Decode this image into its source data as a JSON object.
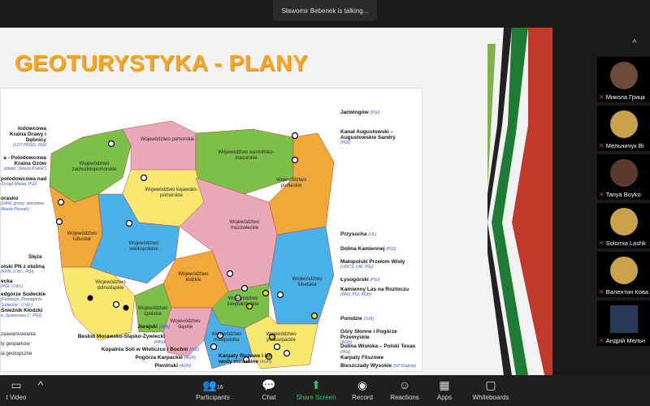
{
  "top_banner": {
    "speaker_text": "Sławomir Bebenek is talking..."
  },
  "slide": {
    "title": "GEOTURYSTYKA - PLANY",
    "regions": [
      {
        "name": "Województwo pomorskie"
      },
      {
        "name": "Województwo warmińsko-mazurskie"
      },
      {
        "name": "Województwo zachodniopomorskie"
      },
      {
        "name": "Województwo kujawsko-pomorskie"
      },
      {
        "name": "Województwo podlaskie"
      },
      {
        "name": "Województwo lubuskie"
      },
      {
        "name": "Województwo wielkopolskie"
      },
      {
        "name": "Województwo mazowieckie"
      },
      {
        "name": "Województwo łódzkie"
      },
      {
        "name": "Województwo lubelskie"
      },
      {
        "name": "Województwo dolnośląskie"
      },
      {
        "name": "Województwo opolskie"
      },
      {
        "name": "Województwo świętokrzyskie"
      },
      {
        "name": "Województwo śląskie"
      },
      {
        "name": "Województwo małopolskie"
      },
      {
        "name": "Województwo podkarpackie"
      }
    ],
    "left_annotations": [
      {
        "title": "lodowcowa Kraina Drawy i Dębnicy",
        "sub": "(LOT PKDiD, PGI)"
      },
      {
        "title": "a - Polodowcowa Kraina Ozów",
        "sub": "zdanie, „Nasza Kraina”)"
      },
      {
        "title": "polodowcowa nad",
        "sub": "(Urząd Miasta, PGI)"
      },
      {
        "title": "orasko",
        "sub": "(UAM, gminy, starostwo, Miasto Poznań)"
      },
      {
        "title": "Ślęża",
        "sub": ""
      },
      {
        "title": "olski PN z otuliną",
        "sub": "(KPN, U.Wr., PGI)"
      },
      {
        "title": "ecka",
        "sub": "(PGI, U.Wr.)"
      },
      {
        "title": "edgórze Sudeckie",
        "sub": "(Fundacja „Przedgórze Sudeckie”, U.Wr.)"
      },
      {
        "title": "Śnieżnik Kłodzki",
        "sub": "a „Spacerowa 1”, PGI)"
      }
    ],
    "right_annotations": [
      {
        "title": "Jaćwingów",
        "sub": "(PGI)"
      },
      {
        "title": "Kanał Augustowski – Augustowskie Sandry",
        "sub": "(PGI)"
      },
      {
        "title": "Przysucha",
        "sub": "(UL)"
      },
      {
        "title": "Dolina Kamiennej",
        "sub": "(PGI)"
      },
      {
        "title": "Małopolski Przełom Wisły",
        "sub": "(UMCS, UW, PGI)"
      },
      {
        "title": "Łysogórski",
        "sub": "(PGI)"
      },
      {
        "title": "Kamienny Las na Roztoczu",
        "sub": "(PAN, PGI, AGH)"
      },
      {
        "title": "Ponidzie",
        "sub": "(UJK)"
      },
      {
        "title": "Góry Słonne i Pogórze Przemyskie",
        "sub": "(AGH)"
      },
      {
        "title": "Dolina Wisłoka – Polski Texas",
        "sub": "(PGI)"
      },
      {
        "title": "Karpaty Fliszowe",
        "sub": ""
      },
      {
        "title": "Bieszczady Wysokie",
        "sub": "(UP Kraków)"
      }
    ],
    "bottom_annotations": [
      {
        "title": "Jurajski",
        "sub": "(PAN)"
      },
      {
        "title": "Beskid Morawsko-Śląsko-Żywiecki",
        "sub": "(PAN)"
      },
      {
        "title": "Kopalnia Soli w Wieliczce i Bochni",
        "sub": "(PGI)"
      },
      {
        "title": "Pogórza Karpackie",
        "sub": "(AGH)"
      },
      {
        "title": "Pieniński",
        "sub": "(AGH)"
      },
      {
        "title": "Karpaty fliszowe i ich wody mineralne",
        "sub": "(AGH)"
      }
    ],
    "legend": [
      "zaawansowania",
      "ty geoparków",
      "ia geologiczne"
    ]
  },
  "participants": [
    {
      "name": "Микола Грицк",
      "color": "#6b4a3a"
    },
    {
      "name": "Мельничук Ві",
      "color": "#c9a14a"
    },
    {
      "name": "Tanya Boyko",
      "color": "#5a3a2a"
    },
    {
      "name": "Solomia Lashk",
      "color": "#c9a14a"
    },
    {
      "name": "Валентин Кова",
      "color": "#c9a14a"
    },
    {
      "name": "Андрій Мельн",
      "color": "#2c3a5a"
    }
  ],
  "toolbar": {
    "video": "t Video",
    "participants": "Participants",
    "participants_count": "16",
    "chat": "Chat",
    "share": "Share Screen",
    "record": "Record",
    "reactions": "Reactions",
    "apps": "Apps",
    "whiteboards": "Whiteboards"
  }
}
